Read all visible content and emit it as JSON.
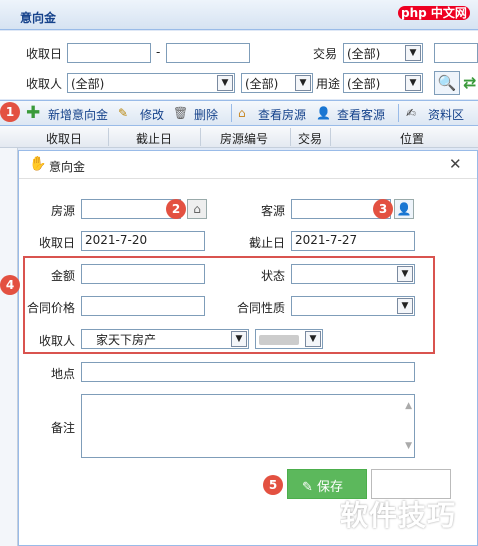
{
  "panel": {
    "title": "意向金"
  },
  "filters": {
    "recv_date_label": "收取日",
    "date_sep": "-",
    "trade_label": "交易",
    "trade_value": "(全部)",
    "receiver_label": "收取人",
    "receiver_value": "(全部)",
    "receiver2_value": "(全部)",
    "purpose_label": "用途",
    "purpose_value": "(全部)"
  },
  "toolbar": {
    "add": "新增意向金",
    "edit": "修改",
    "delete": "删除",
    "view_house": "查看房源",
    "view_client": "查看客源",
    "docs": "资料区"
  },
  "grid": {
    "columns": [
      "收取日",
      "截止日",
      "房源编号",
      "交易",
      "位置"
    ]
  },
  "dialog": {
    "title": "意向金",
    "house_label": "房源",
    "client_label": "客源",
    "recv_date_label": "收取日",
    "recv_date_value": "2021-7-20",
    "end_date_label": "截止日",
    "end_date_value": "2021-7-27",
    "amount_label": "金额",
    "status_label": "状态",
    "contract_price_label": "合同价格",
    "contract_type_label": "合同性质",
    "receiver_label": "收取人",
    "receiver_value": "家天下房产",
    "location_label": "地点",
    "remark_label": "备注",
    "save_label": "保存"
  },
  "badges": [
    "1",
    "2",
    "3",
    "4",
    "5"
  ],
  "watermarks": {
    "top_right": "php 中文网",
    "bottom_right": "软件技巧"
  },
  "colors": {
    "accent": "#15428b",
    "badge": "#e35141",
    "save": "#5cb85c",
    "highlight_box": "#d9534f"
  }
}
